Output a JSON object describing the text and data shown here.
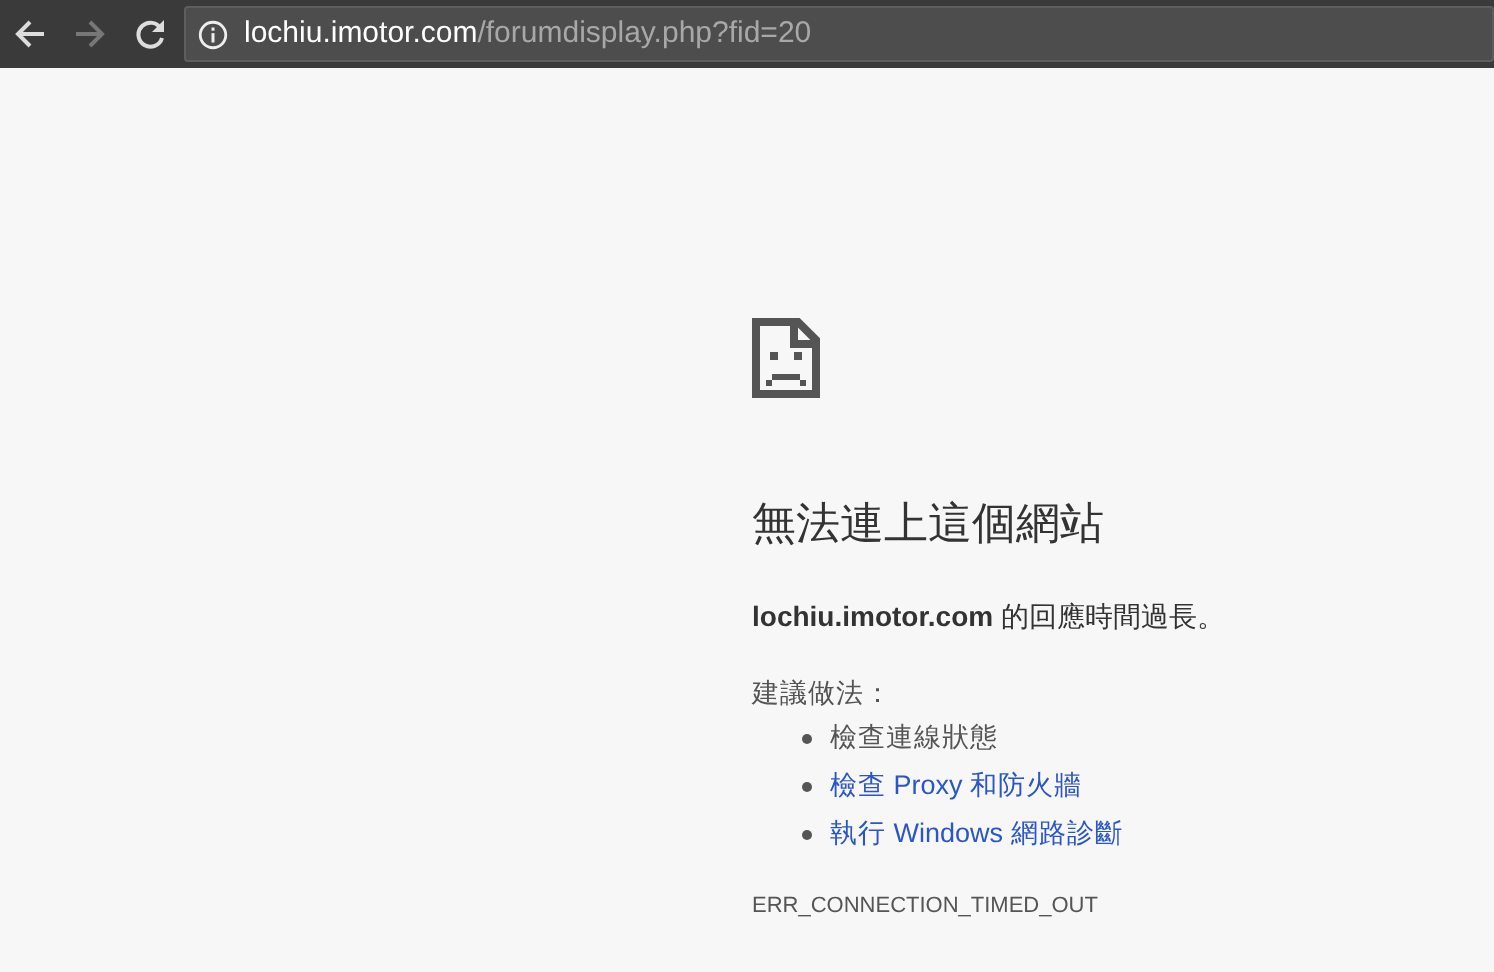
{
  "toolbar": {
    "back_disabled": false,
    "forward_disabled": true,
    "url_host": "lochiu.imotor.com",
    "url_path": "/forumdisplay.php?fid=20"
  },
  "error": {
    "title": "無法連上這個網站",
    "message": "**lochiu.imotor.com** 的回應時間過長。",
    "suggestions_label": "建議做法：",
    "suggestions": [
      {
        "kind": "text",
        "text": "檢查連線狀態"
      },
      {
        "kind": "link",
        "text": "檢查 Proxy 和防火牆"
      },
      {
        "kind": "link",
        "text": "執行 Windows 網路診斷"
      }
    ],
    "code": "ERR_CONNECTION_TIMED_OUT"
  }
}
